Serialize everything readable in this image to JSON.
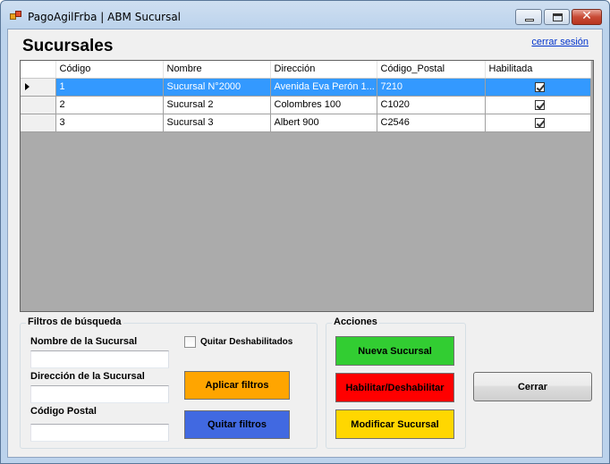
{
  "window": {
    "title": "PagoAgilFrba | ABM Sucursal",
    "controls": {
      "minimize_icon": "minimize-icon",
      "maximize_icon": "maximize-icon",
      "close_glyph": "✕"
    }
  },
  "header": {
    "title": "Sucursales",
    "logout_link": "cerrar sesión"
  },
  "grid": {
    "columns": [
      "Código",
      "Nombre",
      "Dirección",
      "Código_Postal",
      "Habilitada"
    ],
    "rows": [
      {
        "codigo": "1",
        "nombre": "Sucursal N°2000",
        "direccion": "Avenida Eva Perón 1...",
        "codigo_postal": "7210",
        "habilitada": true,
        "selected": true
      },
      {
        "codigo": "2",
        "nombre": "Sucursal 2",
        "direccion": "Colombres 100",
        "codigo_postal": "C1020",
        "habilitada": true,
        "selected": false
      },
      {
        "codigo": "3",
        "nombre": "Sucursal 3",
        "direccion": "Albert 900",
        "codigo_postal": "C2546",
        "habilitada": true,
        "selected": false
      }
    ],
    "selection_color": "#3399ff"
  },
  "filters": {
    "group_title": "Filtros de búsqueda",
    "nombre_label": "Nombre de la Sucursal",
    "nombre_value": "",
    "direccion_label": "Dirección de la Sucursal",
    "direccion_value": "",
    "codigo_postal_label": "Código Postal",
    "codigo_postal_value": "",
    "quitar_deshabilitados_label": "Quitar Deshabilitados",
    "quitar_deshabilitados_checked": false,
    "apply_button": "Aplicar filtros",
    "clear_button": "Quitar filtros"
  },
  "actions": {
    "group_title": "Acciones",
    "new_button": "Nueva Sucursal",
    "toggle_button": "Habilitar/Deshabilitar",
    "edit_button": "Modificar Sucursal"
  },
  "footer": {
    "close_button": "Cerrar"
  },
  "colors": {
    "apply": "#ffa500",
    "clear": "#4169e1",
    "new": "#32cd32",
    "toggle": "#ff0000",
    "edit": "#ffd700"
  }
}
